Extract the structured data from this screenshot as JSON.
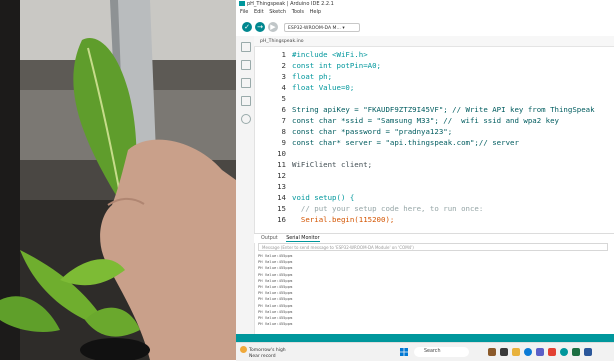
{
  "window": {
    "title": "pH_Thingspeak | Arduino IDE 2.2.1"
  },
  "menu": [
    "File",
    "Edit",
    "Sketch",
    "Tools",
    "Help"
  ],
  "toolbar": {
    "board": "ESP32-WROOM-DA M..."
  },
  "tab": {
    "filename": "pH_Thingspeak.ino"
  },
  "code_lines": [
    {
      "n": "1",
      "code": "#include <WiFi.h>"
    },
    {
      "n": "2",
      "code": "const int potPin=A0;"
    },
    {
      "n": "3",
      "code": "float ph;"
    },
    {
      "n": "4",
      "code": "float Value=0;"
    },
    {
      "n": "5",
      "code": ""
    },
    {
      "n": "6",
      "code": "String apiKey = \"FKAUDF9ZTZ9I45VF\"; // Write API key from ThingSpeak"
    },
    {
      "n": "7",
      "code": "const char *ssid = \"Samsung M33\"; //  wifi ssid and wpa2 key"
    },
    {
      "n": "8",
      "code": "const char *password = \"pradnya123\";"
    },
    {
      "n": "9",
      "code": "const char* server = \"api.thingspeak.com\";// server"
    },
    {
      "n": "10",
      "code": ""
    },
    {
      "n": "11",
      "code": "WiFiClient client;"
    },
    {
      "n": "12",
      "code": ""
    },
    {
      "n": "13",
      "code": ""
    },
    {
      "n": "14",
      "code": "void setup() {"
    },
    {
      "n": "15",
      "code": "  // put your setup code here, to run once:"
    },
    {
      "n": "16",
      "code": "  Serial.begin(115200);"
    }
  ],
  "panel": {
    "tab_output": "Output",
    "tab_serial": "Serial Monitor",
    "input_placeholder": "Message (Enter to send message to 'ESP32-WROOM-DA Module' on 'COM4')"
  },
  "serial_lines": [
    "PH Value:455ppm",
    "PH Value:455ppm",
    "PH Value:455ppm",
    "PH Value:455ppm",
    "PH Value:455ppm",
    "PH Value:455ppm",
    "PH Value:455ppm",
    "PH Value:455ppm",
    "PH Value:455ppm",
    "PH Value:455ppm",
    "PH Value:455ppm",
    "PH Value:455ppm"
  ],
  "taskbar": {
    "weather_line1": "Tomorrow's high",
    "weather_line2": "Near record",
    "search": "Search"
  },
  "colors": {
    "accent": "#00979c",
    "status": "#00979c"
  }
}
